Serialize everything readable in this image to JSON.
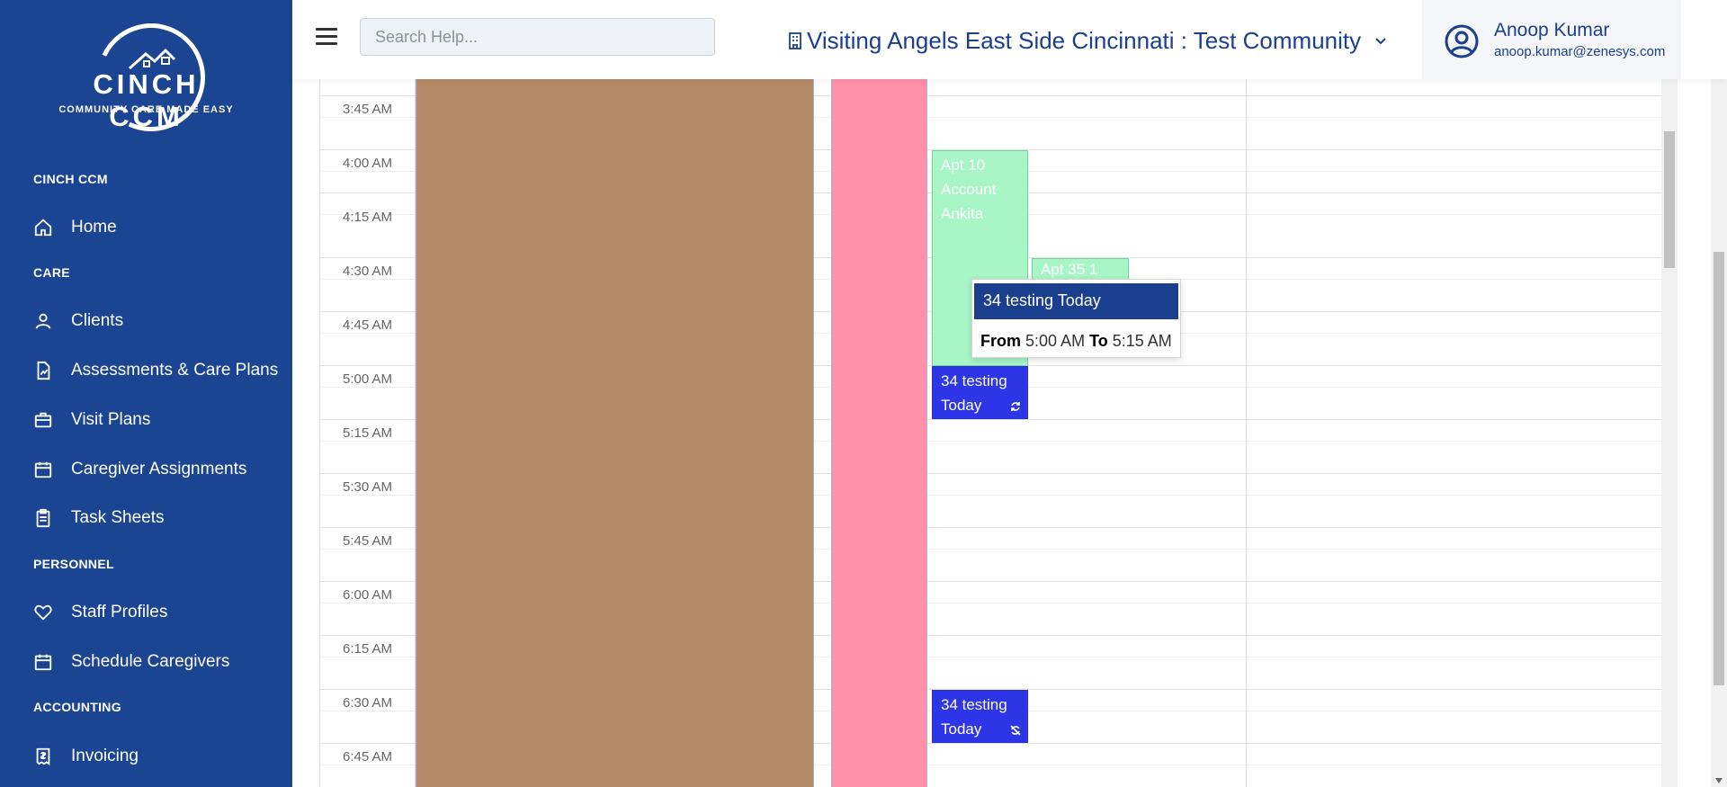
{
  "sidebar": {
    "logo": {
      "brand": "CINCH CCM",
      "tagline": "COMMUNITY CARE MADE EASY"
    },
    "sections": [
      {
        "title": "CINCH CCM"
      },
      {
        "title": "CARE"
      },
      {
        "title": "PERSONNEL"
      },
      {
        "title": "ACCOUNTING"
      }
    ],
    "items": [
      {
        "label": "Home",
        "icon": "home-icon"
      },
      {
        "label": "Clients",
        "icon": "user-icon"
      },
      {
        "label": "Assessments & Care Plans",
        "icon": "document-chart-icon"
      },
      {
        "label": "Visit Plans",
        "icon": "briefcase-icon"
      },
      {
        "label": "Caregiver Assignments",
        "icon": "calendar-icon"
      },
      {
        "label": "Task Sheets",
        "icon": "clipboard-icon"
      },
      {
        "label": "Staff Profiles",
        "icon": "heart-hand-icon"
      },
      {
        "label": "Schedule Caregivers",
        "icon": "calendar-icon"
      },
      {
        "label": "Invoicing",
        "icon": "invoice-icon"
      }
    ]
  },
  "header": {
    "search_placeholder": "Search Help...",
    "community": "Visiting Angels East Side Cincinnati : Test Community",
    "user_name": "Anoop Kumar",
    "user_email": "anoop.kumar@zenesys.com"
  },
  "calendar": {
    "times": [
      "3:45 AM",
      "4:00 AM",
      "4:15 AM",
      "4:30 AM",
      "4:45 AM",
      "5:00 AM",
      "5:15 AM",
      "5:30 AM",
      "5:45 AM",
      "6:00 AM",
      "6:15 AM",
      "6:30 AM",
      "6:45 AM"
    ],
    "events": [
      {
        "lines": [
          "Apt 10",
          "Account",
          "Ankita"
        ]
      },
      {
        "lines": [
          "Apt 35 1"
        ]
      },
      {
        "lines": [
          "34 testing",
          "Today"
        ],
        "icon": "recurring-icon"
      },
      {
        "lines": [
          "34 testing",
          "Today"
        ],
        "icon": "recurring-off-icon"
      }
    ],
    "tooltip": {
      "title": "34 testing Today",
      "from_label": "From",
      "from_time": "5:00 AM",
      "to_label": "To",
      "to_time": "5:15 AM"
    }
  },
  "colors": {
    "sidebar": "#1b4593",
    "band_brown": "#b58a67",
    "band_pink": "#ff91a9",
    "event_green": "#a8f5c6",
    "event_blue": "#2e35e6",
    "tooltip_header": "#1b3f8f"
  }
}
